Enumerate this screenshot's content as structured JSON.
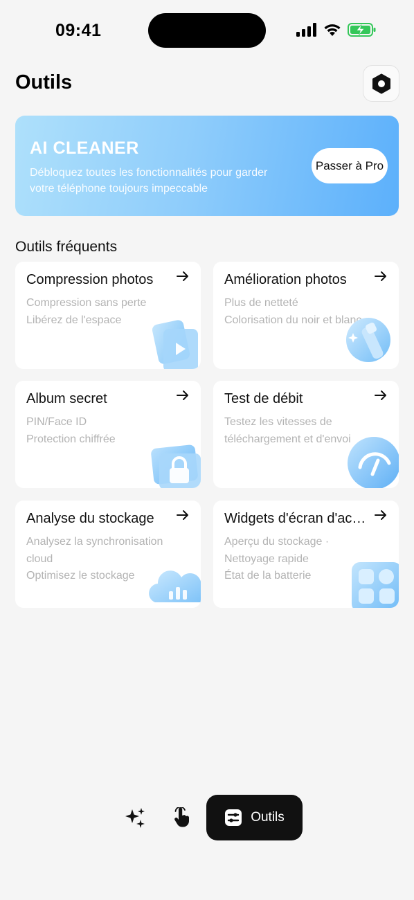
{
  "status_bar": {
    "time": "09:41"
  },
  "header": {
    "title": "Outils"
  },
  "banner": {
    "title": "AI CLEANER",
    "description": "Débloquez toutes les fonctionnalités pour garder votre téléphone toujours impeccable",
    "cta_label": "Passer à Pro"
  },
  "section": {
    "title": "Outils fréquents"
  },
  "tools": [
    {
      "title": "Compression photos",
      "lines": [
        "Compression sans perte",
        "Libérez de l'espace"
      ],
      "icon": "photo-compress-icon"
    },
    {
      "title": "Amélioration photos",
      "lines": [
        "Plus de netteté",
        "Colorisation du noir et blanc"
      ],
      "icon": "photo-enhance-icon"
    },
    {
      "title": "Album secret",
      "lines": [
        "PIN/Face ID",
        "Protection chiffrée"
      ],
      "icon": "lock-album-icon"
    },
    {
      "title": "Test de débit",
      "lines": [
        "Testez les vitesses de",
        "téléchargement et d'envoi"
      ],
      "icon": "speedometer-icon"
    },
    {
      "title": "Analyse du stockage",
      "lines": [
        "Analysez la synchronisation",
        "cloud",
        "Optimisez le stockage"
      ],
      "icon": "cloud-chart-icon"
    },
    {
      "title": "Widgets d'écran d'accueil",
      "lines": [
        "Aperçu du stockage ·",
        "Nettoyage rapide",
        "État de la batterie"
      ],
      "icon": "widgets-icon"
    }
  ],
  "bottom_nav": {
    "items": [
      {
        "icon": "sparkles-icon"
      },
      {
        "icon": "tap-hand-icon"
      },
      {
        "icon": "tools-icon",
        "label": "Outils",
        "active": true
      }
    ]
  },
  "colors": {
    "accent": "#5cb0fb",
    "banner_start": "#aee0fb",
    "active_nav": "#111111",
    "battery": "#34c759"
  }
}
